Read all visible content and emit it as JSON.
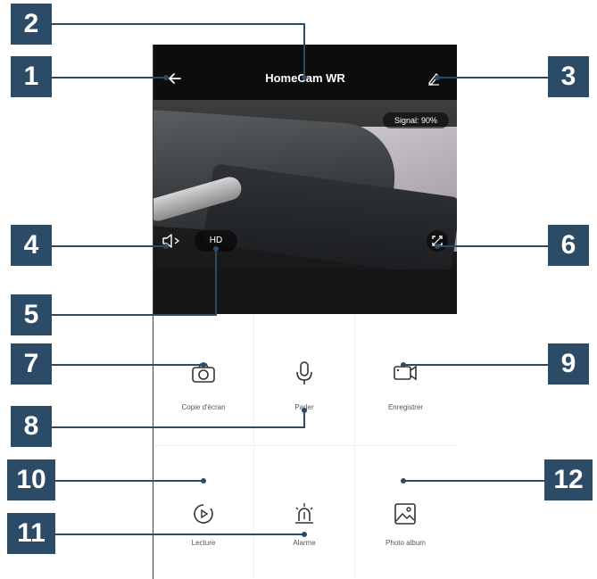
{
  "app": {
    "title": "HomeCam WR",
    "signal": "Signal: 90%",
    "hd_label": "HD"
  },
  "icons": {
    "back": "back-arrow-icon",
    "edit": "pencil-edit-icon",
    "mute": "speaker-mute-icon",
    "fullscreen": "fullscreen-icon",
    "screenshot": "camera-icon",
    "talk": "microphone-icon",
    "record": "video-camera-icon",
    "playback": "play-circle-icon",
    "alarm": "siren-icon",
    "album": "photo-icon"
  },
  "controls": [
    {
      "label": "Copie d'écran"
    },
    {
      "label": "Parler"
    },
    {
      "label": "Enregistrer"
    },
    {
      "label": "Lecture"
    },
    {
      "label": "Alarme"
    },
    {
      "label": "Photo album"
    }
  ],
  "callouts": [
    "1",
    "2",
    "3",
    "4",
    "5",
    "6",
    "7",
    "8",
    "9",
    "10",
    "11",
    "12"
  ],
  "colors": {
    "callout": "#2b4b66",
    "header": "#0d0d0d"
  }
}
